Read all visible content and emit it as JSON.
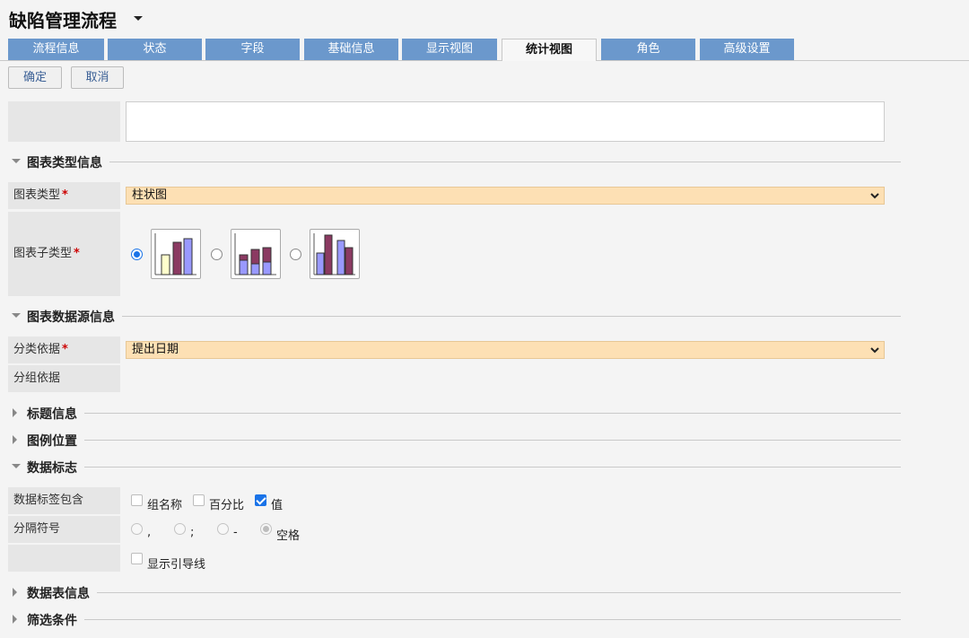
{
  "header": {
    "title": "缺陷管理流程"
  },
  "tabs": [
    {
      "label": "流程信息"
    },
    {
      "label": "状态"
    },
    {
      "label": "字段"
    },
    {
      "label": "基础信息"
    },
    {
      "label": "显示视图"
    },
    {
      "label": "统计视图",
      "active": true
    },
    {
      "label": "角色"
    },
    {
      "label": "高级设置"
    }
  ],
  "toolbar": {
    "confirm_label": "确定",
    "cancel_label": "取消"
  },
  "sections": {
    "chart_type_info": "图表类型信息",
    "chart_datasource_info": "图表数据源信息",
    "title_info": "标题信息",
    "legend_position": "图例位置",
    "data_labels": "数据标志",
    "data_table_info": "数据表信息",
    "filter_conditions": "筛选条件"
  },
  "fields": {
    "chart_type": {
      "label": "图表类型",
      "value": "柱状图"
    },
    "chart_subtype": {
      "label": "图表子类型",
      "selected_index": 0
    },
    "category_basis": {
      "label": "分类依据",
      "value": "提出日期"
    },
    "group_basis": {
      "label": "分组依据"
    },
    "data_label_includes": {
      "label": "数据标签包含",
      "options": [
        {
          "label": "组名称",
          "checked": false
        },
        {
          "label": "百分比",
          "checked": false
        },
        {
          "label": "值",
          "checked": true
        }
      ]
    },
    "separator": {
      "label": "分隔符号",
      "options": [
        {
          "label": ",",
          "selected": false
        },
        {
          "label": ";",
          "selected": false
        },
        {
          "label": "-",
          "selected": false
        },
        {
          "label": "空格",
          "selected": true
        }
      ]
    },
    "show_leader_lines": {
      "label": "显示引导线",
      "checked": false
    }
  },
  "required_mark": "*",
  "colors": {
    "tab_bg": "#6b98cc",
    "select_bg": "#fde0b4",
    "accent": "#1a73e8",
    "bar_maroon": "#8b3a62",
    "bar_lavender": "#9999ff",
    "bar_cream": "#ffffcc"
  }
}
